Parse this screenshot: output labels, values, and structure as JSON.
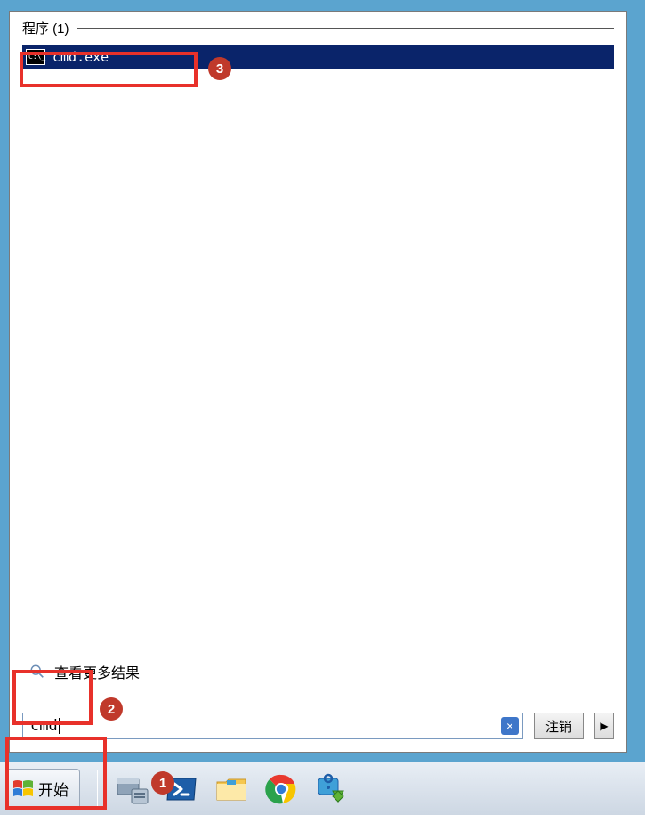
{
  "section": {
    "title": "程序 (1)"
  },
  "results": [
    {
      "label": "cmd.exe",
      "icon_text": "C:\\_"
    }
  ],
  "see_more": {
    "label": "查看更多结果"
  },
  "search": {
    "value": "cmd",
    "clear": "✕"
  },
  "logoff": {
    "label": "注销",
    "arrow": "▶"
  },
  "start": {
    "label": "开始"
  },
  "annotations": {
    "a1": "1",
    "a2": "2",
    "a3": "3"
  }
}
